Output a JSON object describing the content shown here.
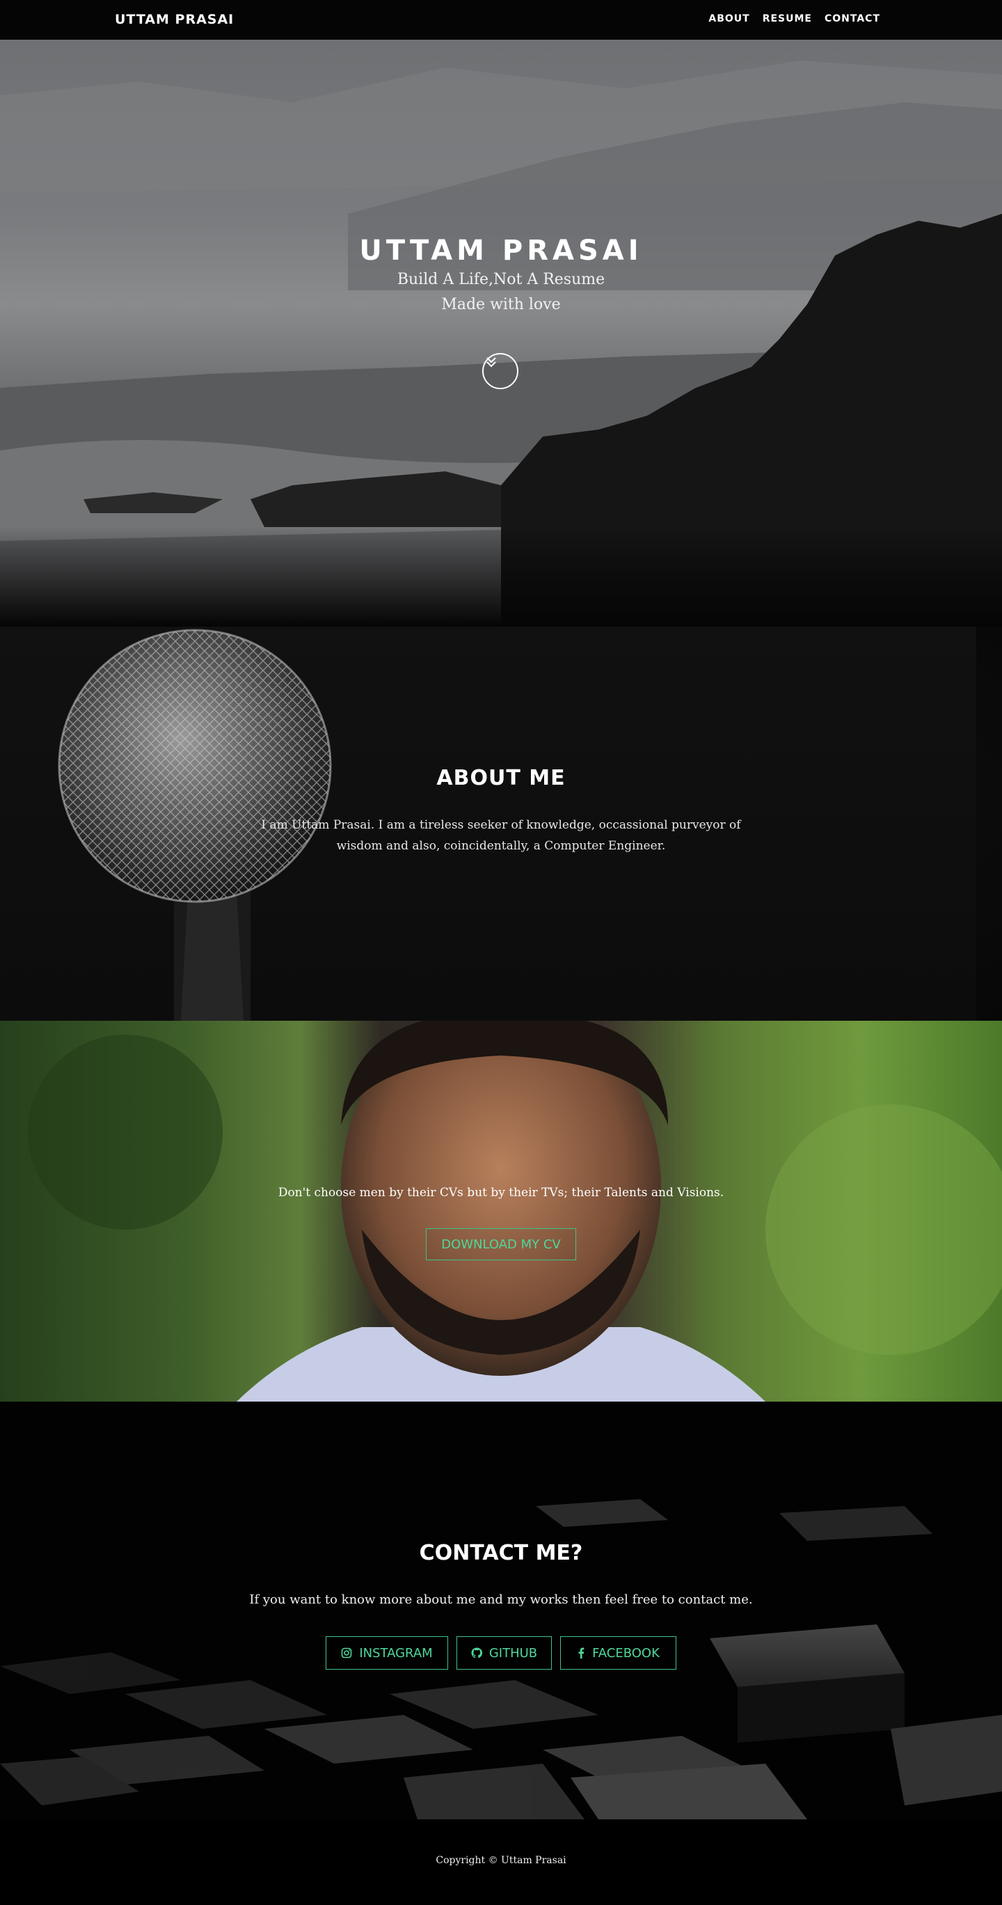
{
  "nav": {
    "brand": "UTTAM PRASAI",
    "links": [
      "ABOUT",
      "RESUME",
      "CONTACT"
    ]
  },
  "hero": {
    "title": "UTTAM PRASAI",
    "subtitle": "Build A Life,Not A Resume",
    "tagline": "Made with love",
    "scroll_icon": "double-chevron-down-icon"
  },
  "about": {
    "title": "ABOUT ME",
    "text": "I am Uttam Prasai. I am a tireless seeker of knowledge, occassional purveyor of wisdom and also, coincidentally, a Computer Engineer."
  },
  "resume": {
    "quote": "Don't choose men by their CVs but by their TVs; their Talents and Visions.",
    "button_label": "DOWNLOAD MY CV"
  },
  "contact": {
    "title": "CONTACT ME?",
    "text": "If you want to know more about me and my works then feel free to contact me.",
    "buttons": [
      {
        "label": "INSTAGRAM",
        "icon": "instagram-icon"
      },
      {
        "label": "GITHUB",
        "icon": "github-icon"
      },
      {
        "label": "FACEBOOK",
        "icon": "facebook-icon"
      }
    ]
  },
  "footer": {
    "copyright": "Copyright © Uttam Prasai"
  },
  "colors": {
    "accent": "#4fd79a",
    "background": "#000000"
  }
}
